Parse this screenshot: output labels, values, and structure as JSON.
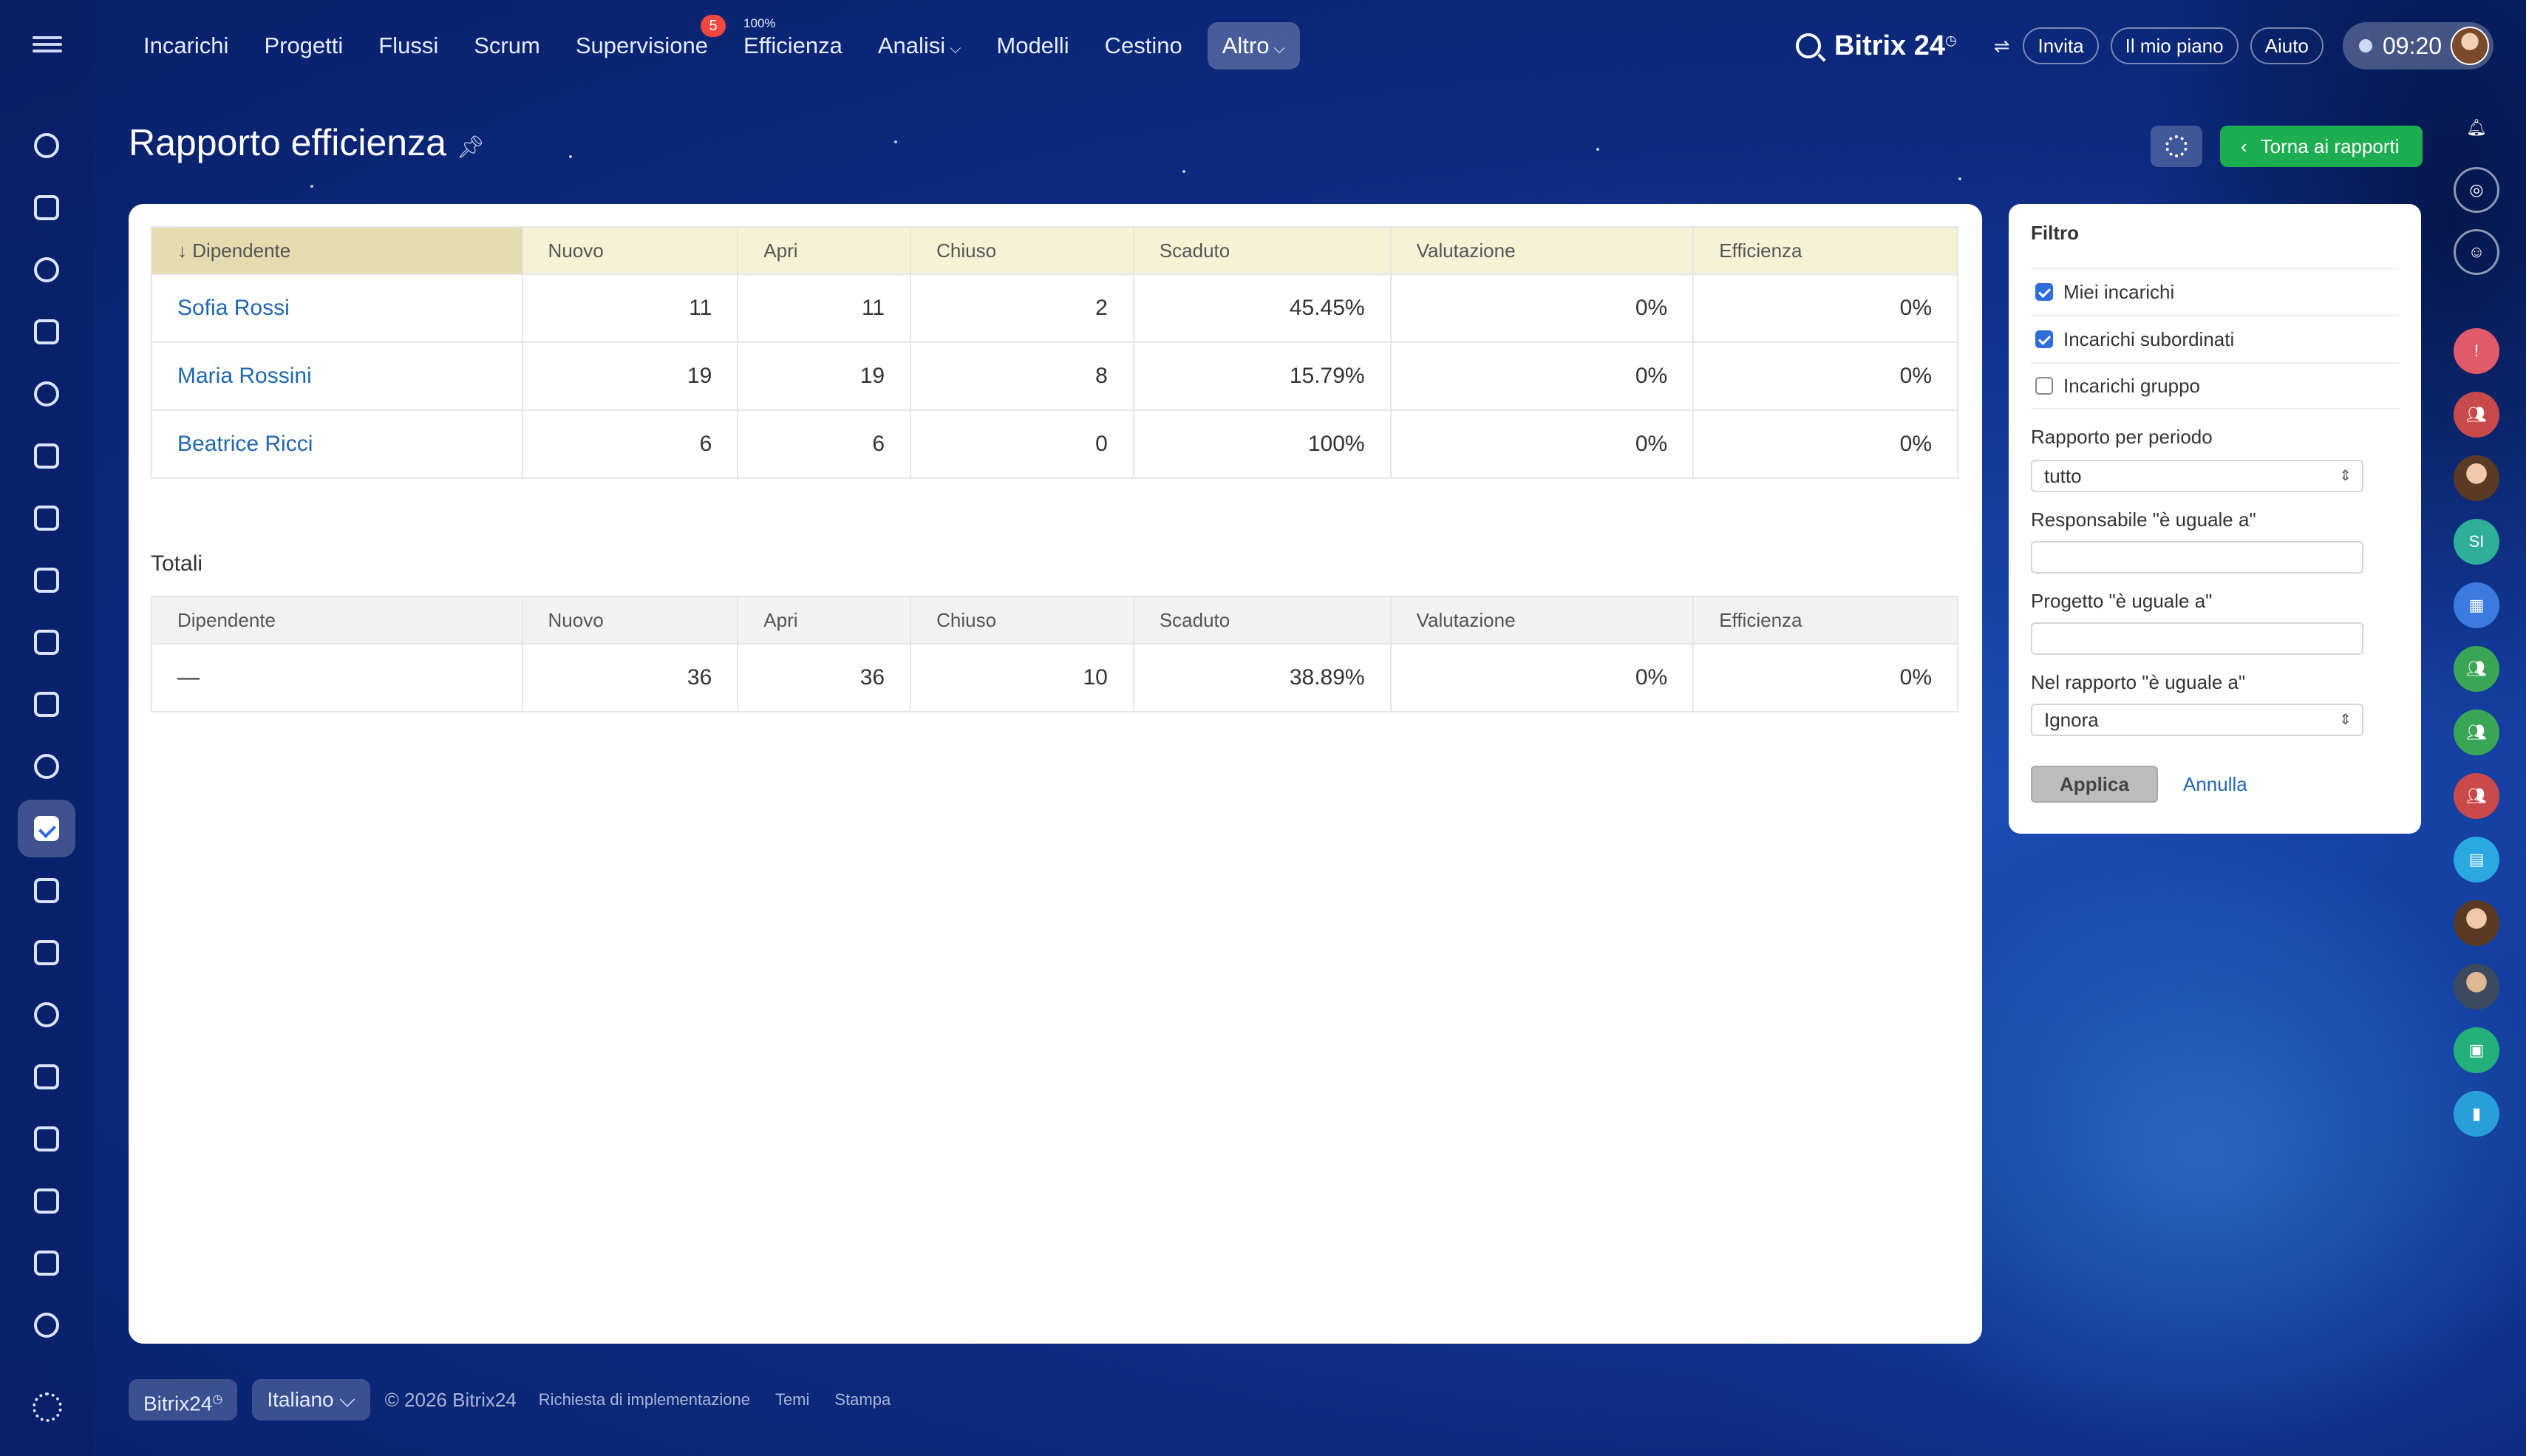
{
  "nav": {
    "items": [
      {
        "label": "Incarichi"
      },
      {
        "label": "Progetti"
      },
      {
        "label": "Flussi"
      },
      {
        "label": "Scrum"
      },
      {
        "label": "Supervisione",
        "badge": "5"
      },
      {
        "label": "Efficienza",
        "super": "100%"
      },
      {
        "label": "Analisi"
      },
      {
        "label": "Modelli"
      },
      {
        "label": "Cestino"
      },
      {
        "label": "Altro"
      }
    ]
  },
  "header": {
    "brand": "Bitrix 24",
    "invite": "Invita",
    "plan": "Il mio piano",
    "help": "Aiuto",
    "time": "09:20"
  },
  "page": {
    "title": "Rapporto efficienza",
    "back_button": "Torna ai rapporti"
  },
  "report": {
    "columns": [
      "Dipendente",
      "Nuovo",
      "Apri",
      "Chiuso",
      "Scaduto",
      "Valutazione",
      "Efficienza"
    ],
    "rows": [
      {
        "name": "Sofia Rossi",
        "nuovo": "11",
        "apri": "11",
        "chiuso": "2",
        "scaduto": "45.45%",
        "valutazione": "0%",
        "efficienza": "0%"
      },
      {
        "name": "Maria Rossini",
        "nuovo": "19",
        "apri": "19",
        "chiuso": "8",
        "scaduto": "15.79%",
        "valutazione": "0%",
        "efficienza": "0%"
      },
      {
        "name": "Beatrice Ricci",
        "nuovo": "6",
        "apri": "6",
        "chiuso": "0",
        "scaduto": "100%",
        "valutazione": "0%",
        "efficienza": "0%"
      }
    ],
    "totals_label": "Totali",
    "totals": {
      "name": "—",
      "nuovo": "36",
      "apri": "36",
      "chiuso": "10",
      "scaduto": "38.89%",
      "valutazione": "0%",
      "efficienza": "0%"
    }
  },
  "filter": {
    "title": "Filtro",
    "checks": [
      {
        "label": "Miei incarichi",
        "checked": true
      },
      {
        "label": "Incarichi subordinati",
        "checked": true
      },
      {
        "label": "Incarichi gruppo",
        "checked": false
      }
    ],
    "period_label": "Rapporto per periodo",
    "period_value": "tutto",
    "responsible_label": "Responsabile \"è uguale a\"",
    "project_label": "Progetto \"è uguale a\"",
    "report_label": "Nel rapporto \"è uguale a\"",
    "report_value": "Ignora",
    "apply": "Applica",
    "cancel": "Annulla"
  },
  "right_rail": {
    "si_initials": "SI"
  },
  "footer": {
    "brand": "Bitrix24",
    "language": "Italiano",
    "copyright": "© 2026 Bitrix24",
    "links": [
      "Richiesta di implementazione",
      "Temi",
      "Stampa"
    ]
  }
}
